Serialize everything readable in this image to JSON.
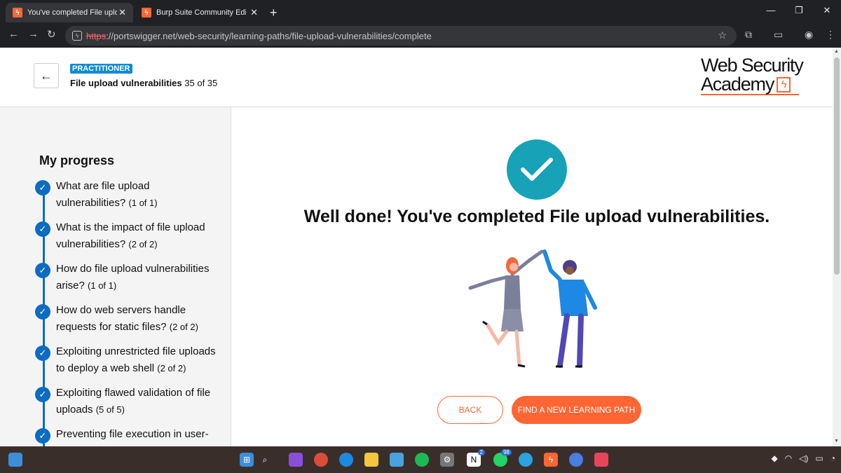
{
  "browser": {
    "tabs": [
      {
        "title": "You've completed File upload v",
        "close": "✕",
        "active": true
      },
      {
        "title": "Burp Suite Community Edition",
        "close": "✕",
        "active": false
      }
    ],
    "new_tab": "+",
    "window_controls": [
      "—",
      "❐",
      "✕"
    ],
    "url_scheme": "https",
    "url_rest": "://portswigger.net/web-security/learning-paths/file-upload-vulnerabilities/complete"
  },
  "header": {
    "badge": "PRACTITIONER",
    "path_name": "File upload vulnerabilities",
    "path_count": "35 of 35",
    "logo_line1": "Web Security",
    "logo_line2": "Academy",
    "logo_bolt": "ϟ"
  },
  "sidebar": {
    "title": "My progress",
    "items": [
      {
        "text": "What are file upload vulnerabilities?",
        "count": "(1 of 1)"
      },
      {
        "text": "What is the impact of file upload vulnerabilities?",
        "count": "(2 of 2)"
      },
      {
        "text": "How do file upload vulnerabilities arise?",
        "count": "(1 of 1)"
      },
      {
        "text": "How do web servers handle requests for static files?",
        "count": "(2 of 2)"
      },
      {
        "text": "Exploiting unrestricted file uploads to deploy a web shell",
        "count": "(2 of 2)"
      },
      {
        "text": "Exploiting flawed validation of file uploads",
        "count": "(5 of 5)"
      },
      {
        "text": "Preventing file execution in user-",
        "count": ""
      }
    ]
  },
  "main": {
    "heading": "Well done! You've completed File upload vulnerabilities.",
    "back_label": "BACK",
    "find_label": "FIND A NEW LEARNING PATH"
  },
  "taskbar": {
    "badges": {
      "whatsapp": "98",
      "notion": "2"
    }
  },
  "colors": {
    "accent": "#ff6633",
    "teal": "#17a2b8",
    "progress_blue": "#0b6cc1",
    "badge_blue": "#0b8ad6"
  }
}
